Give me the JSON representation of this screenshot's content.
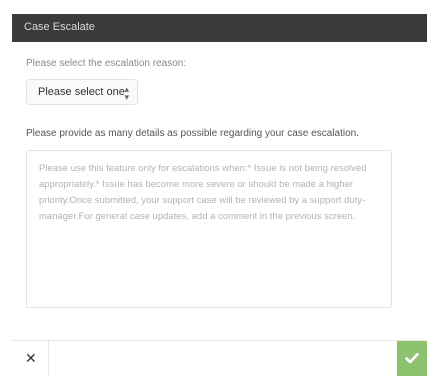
{
  "dialog": {
    "title": "Case Escalate",
    "reason_prompt": "Please select the escalation reason:",
    "reason_select": {
      "selected": "Please select one"
    },
    "details_prompt": "Please provide as many details as possible regarding your case escalation.",
    "details_textarea": {
      "placeholder": "Please use this feature only for escalations when:* Issue is not being resolved appropriately.* Issue has become more severe or should be made a higher priority.Once submitted, your support case will be reviewed by a support duty-manager.For general case updates, add a comment in the previous screen.",
      "value": ""
    },
    "footer": {
      "close_icon": "close-icon",
      "submit_icon": "check-icon"
    }
  },
  "colors": {
    "titlebar": "#3b3b3b",
    "submit": "#8dc26f"
  }
}
